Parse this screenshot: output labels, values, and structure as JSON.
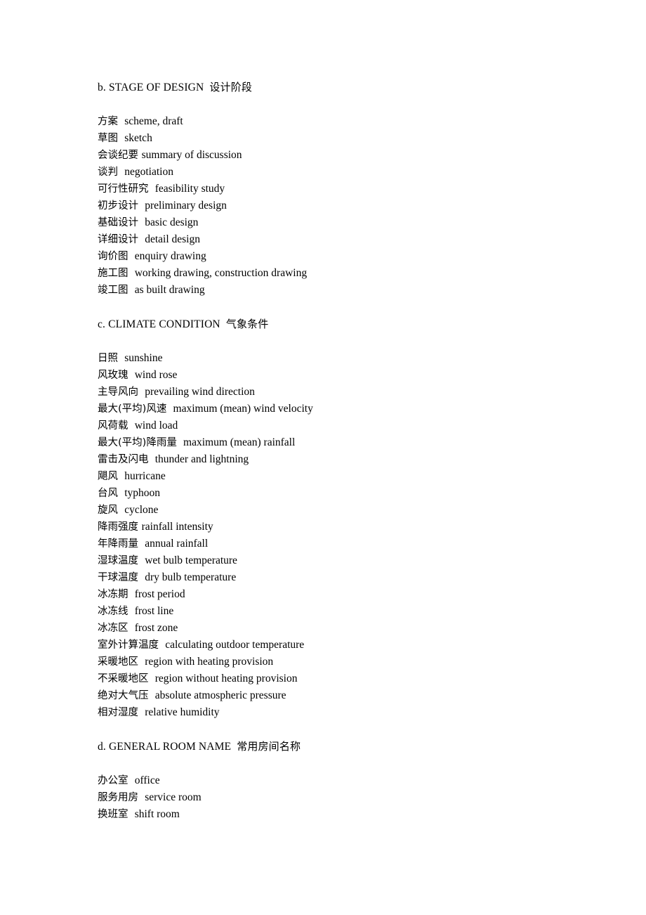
{
  "document": {
    "page_background": "#ffffff",
    "text_color": "#000000",
    "sections": [
      {
        "id": "stage-of-design",
        "marker": "b.",
        "title_en": "STAGE OF DESIGN",
        "title_cn": "设计阶段",
        "heading": "b. STAGE OF DESIGN  设计阶段",
        "entries": [
          {
            "term": "方案",
            "sep": "  ",
            "gloss": "scheme, draft"
          },
          {
            "term": "草图",
            "sep": "  ",
            "gloss": "sketch"
          },
          {
            "term": "会谈纪要",
            "sep": " ",
            "gloss": "summary of discussion"
          },
          {
            "term": "谈判",
            "sep": "  ",
            "gloss": "negotiation"
          },
          {
            "term": "可行性研究",
            "sep": "  ",
            "gloss": "feasibility study"
          },
          {
            "term": "初步设计",
            "sep": "  ",
            "gloss": "preliminary design"
          },
          {
            "term": "基础设计",
            "sep": "  ",
            "gloss": "basic design"
          },
          {
            "term": "详细设计",
            "sep": "  ",
            "gloss": "detail design"
          },
          {
            "term": "询价图",
            "sep": "  ",
            "gloss": "enquiry drawing"
          },
          {
            "term": "施工图",
            "sep": "  ",
            "gloss": "working drawing, construction drawing"
          },
          {
            "term": "竣工图",
            "sep": "  ",
            "gloss": "as built drawing"
          }
        ]
      },
      {
        "id": "climate-condition",
        "marker": "c.",
        "title_en": "CLIMATE CONDITION",
        "title_cn": "气象条件",
        "heading": "c. CLIMATE CONDITION  气象条件",
        "entries": [
          {
            "term": "日照",
            "sep": "  ",
            "gloss": "sunshine"
          },
          {
            "term": "风玫瑰",
            "sep": "  ",
            "gloss": "wind rose"
          },
          {
            "term": "主导风向",
            "sep": "  ",
            "gloss": "prevailing wind direction"
          },
          {
            "term": "最大(平均)风速",
            "sep": "  ",
            "gloss": "maximum (mean) wind velocity"
          },
          {
            "term": "风荷载",
            "sep": "  ",
            "gloss": "wind load"
          },
          {
            "term": "最大(平均)降雨量",
            "sep": "  ",
            "gloss": "maximum (mean) rainfall"
          },
          {
            "term": "雷击及闪电",
            "sep": "  ",
            "gloss": "thunder and lightning"
          },
          {
            "term": "飓风",
            "sep": "  ",
            "gloss": "hurricane"
          },
          {
            "term": "台风",
            "sep": "  ",
            "gloss": "typhoon"
          },
          {
            "term": "旋风",
            "sep": "  ",
            "gloss": "cyclone"
          },
          {
            "term": "降雨强度",
            "sep": " ",
            "gloss": "rainfall intensity"
          },
          {
            "term": "年降雨量",
            "sep": "  ",
            "gloss": "annual rainfall"
          },
          {
            "term": "湿球温度",
            "sep": "  ",
            "gloss": "wet bulb temperature"
          },
          {
            "term": "干球温度",
            "sep": "  ",
            "gloss": "dry bulb temperature"
          },
          {
            "term": "冰冻期",
            "sep": "  ",
            "gloss": "frost period"
          },
          {
            "term": "冰冻线",
            "sep": "  ",
            "gloss": "frost line"
          },
          {
            "term": "冰冻区",
            "sep": "  ",
            "gloss": "frost zone"
          },
          {
            "term": "室外计算温度",
            "sep": "  ",
            "gloss": "calculating outdoor temperature"
          },
          {
            "term": "采暖地区",
            "sep": "  ",
            "gloss": "region with heating provision"
          },
          {
            "term": "不采暖地区",
            "sep": "  ",
            "gloss": "region without heating provision"
          },
          {
            "term": "绝对大气压",
            "sep": "  ",
            "gloss": "absolute atmospheric pressure"
          },
          {
            "term": "相对湿度",
            "sep": "  ",
            "gloss": "relative humidity"
          }
        ]
      },
      {
        "id": "general-room-name",
        "marker": "d.",
        "title_en": "GENERAL ROOM NAME",
        "title_cn": "常用房间名称",
        "heading": "d. GENERAL ROOM NAME  常用房间名称",
        "entries": [
          {
            "term": "办公室",
            "sep": "  ",
            "gloss": "office"
          },
          {
            "term": "服务用房",
            "sep": "  ",
            "gloss": "service room"
          },
          {
            "term": "换班室",
            "sep": "  ",
            "gloss": "shift room"
          }
        ]
      }
    ]
  }
}
